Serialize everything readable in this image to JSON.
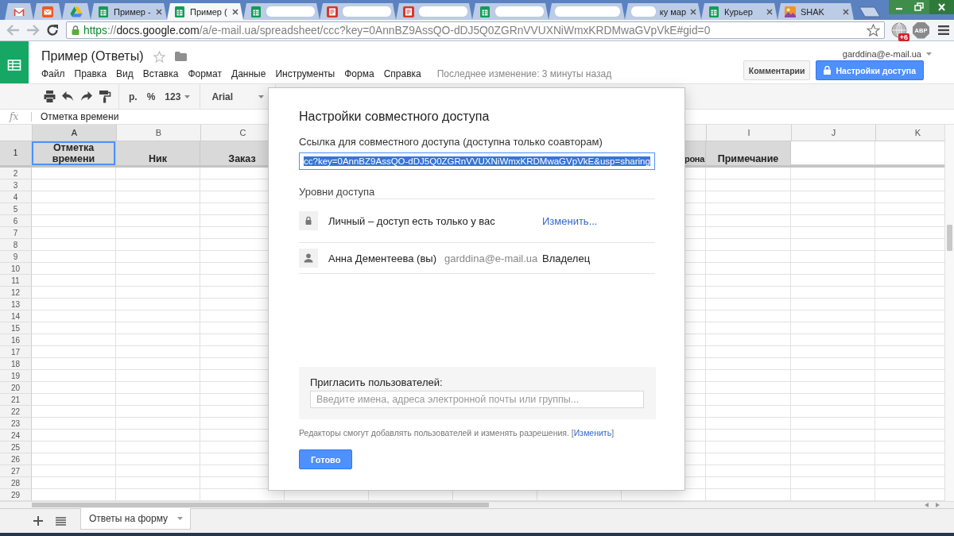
{
  "browser": {
    "tabs": [
      {
        "kind": "mail",
        "pinned": true,
        "redacted": false,
        "selected": false
      },
      {
        "kind": "letter",
        "pinned": true,
        "redacted": false,
        "selected": false
      },
      {
        "kind": "drive",
        "pinned": true,
        "redacted": false,
        "selected": false
      },
      {
        "kind": "sheet",
        "label": "Пример -",
        "pinned": false,
        "redacted": false,
        "selected": false
      },
      {
        "kind": "sheet",
        "label": "Пример (",
        "pinned": false,
        "redacted": false,
        "selected": true
      },
      {
        "kind": "sheet",
        "pinned": false,
        "redacted": true,
        "selected": false
      },
      {
        "kind": "document",
        "pinned": false,
        "redacted": true,
        "selected": false
      },
      {
        "kind": "document",
        "pinned": false,
        "redacted": true,
        "selected": false
      },
      {
        "kind": "sheet",
        "pinned": false,
        "redacted": true,
        "selected": false
      },
      {
        "kind": "blank",
        "pinned": false,
        "redacted": true,
        "selected": false
      },
      {
        "kind": "blank",
        "label": "ку мар",
        "pinned": false,
        "redacted": true,
        "selected": false
      },
      {
        "kind": "sheet",
        "label": "Курьер",
        "pinned": false,
        "redacted": false,
        "selected": false
      },
      {
        "kind": "picture",
        "label": "SHAK",
        "pinned": false,
        "redacted": false,
        "selected": false
      }
    ],
    "nav": {
      "back_enabled": false,
      "forward_enabled": false
    },
    "address_bar": {
      "scheme": "https",
      "separator": "://",
      "host": "docs.google.com",
      "path": "/a/e-mail.ua/spreadsheet/ccc?key=0AnnBZ9AssQO-dDJ5Q0ZGRnVVUXNiWmxKRDMwaGVpVkE#gid=0",
      "bookmarked": false
    },
    "extensions": [
      {
        "kind": "notifier",
        "badge": "+6"
      },
      {
        "kind": "blocker",
        "label": "ABP"
      }
    ]
  },
  "doc": {
    "title": "Пример (Ответы)",
    "starred": false,
    "menu": [
      "Файл",
      "Правка",
      "Вид",
      "Вставка",
      "Формат",
      "Данные",
      "Инструменты",
      "Форма",
      "Справка"
    ],
    "last_edit": "Последнее изменение: 3 минуты назад",
    "account": "garddina@e-mail.ua",
    "buttons": [
      {
        "kind": "comments",
        "label": "Комментарии"
      },
      {
        "kind": "share",
        "label": "Настройки доступа"
      }
    ]
  },
  "toolbar": {
    "currency": "р.",
    "percent": "%",
    "number_format": "123",
    "font": "Arial"
  },
  "formula_bar": {
    "symbol": "fx",
    "value": "Отметка времени"
  },
  "sheet": {
    "columns": [
      {
        "kind": "full",
        "letter": "A",
        "title": "Отметка времени",
        "selected": true
      },
      {
        "kind": "full",
        "letter": "B",
        "title": "Ник",
        "selected": false
      },
      {
        "kind": "full",
        "letter": "C",
        "title": "Заказ",
        "selected": false
      },
      {
        "kind": "partial",
        "title": "рона",
        "selected": false
      },
      {
        "kind": "full",
        "letter": "I",
        "title": "Примечание",
        "selected": false
      },
      {
        "kind": "full",
        "letter": "J",
        "selected": false
      },
      {
        "kind": "full",
        "letter": "K",
        "selected": false
      }
    ],
    "rows": [
      {
        "number": "1",
        "selected": true
      },
      {
        "number": "2",
        "selected": false
      },
      {
        "number": "3",
        "selected": false
      },
      {
        "number": "4",
        "selected": false
      },
      {
        "number": "5",
        "selected": false
      },
      {
        "number": "6",
        "selected": false
      },
      {
        "number": "7",
        "selected": false
      },
      {
        "number": "8",
        "selected": false
      },
      {
        "number": "9",
        "selected": false
      },
      {
        "number": "10",
        "selected": false
      },
      {
        "number": "11",
        "selected": false
      },
      {
        "number": "12",
        "selected": false
      },
      {
        "number": "13",
        "selected": false
      },
      {
        "number": "14",
        "selected": false
      },
      {
        "number": "15",
        "selected": false
      },
      {
        "number": "16",
        "selected": false
      },
      {
        "number": "17",
        "selected": false
      },
      {
        "number": "18",
        "selected": false
      },
      {
        "number": "19",
        "selected": false
      },
      {
        "number": "20",
        "selected": false
      },
      {
        "number": "21",
        "selected": false
      },
      {
        "number": "22",
        "selected": false
      },
      {
        "number": "23",
        "selected": false
      },
      {
        "number": "24",
        "selected": false
      },
      {
        "number": "25",
        "selected": false
      },
      {
        "number": "26",
        "selected": false
      },
      {
        "number": "27",
        "selected": false
      },
      {
        "number": "28",
        "selected": false
      },
      {
        "number": "29",
        "selected": false
      }
    ]
  },
  "sheet_tabs": [
    {
      "label": "Ответы на форму",
      "selected": true
    }
  ],
  "dialog": {
    "title": "Настройки совместного доступа",
    "link_label": "Ссылка для совместного доступа (доступна только соавторам)",
    "link": "cc?key=0AnnBZ9AssQO-dDJ5Q0ZGRnVVUXNiWmxKRDMwaGVpVkE&usp=sharing",
    "link_selected": true,
    "access_heading": "Уровни доступа",
    "access": [
      {
        "kind": "visibility",
        "name": "Личный – доступ есть только у вас",
        "action": "Изменить..."
      },
      {
        "kind": "person",
        "name": "Анна Дементеева (вы)",
        "email": "garddina@e-mail.ua",
        "role": "Владелец"
      }
    ],
    "invite": {
      "label": "Пригласить пользователей:",
      "placeholder": "Введите имена, адреса электронной почты или группы..."
    },
    "note": {
      "text": "Редакторы смогут добавлять пользователей и изменять разрешения.",
      "open": "[",
      "link": "Изменить",
      "close": "]"
    },
    "done": "Готово"
  }
}
